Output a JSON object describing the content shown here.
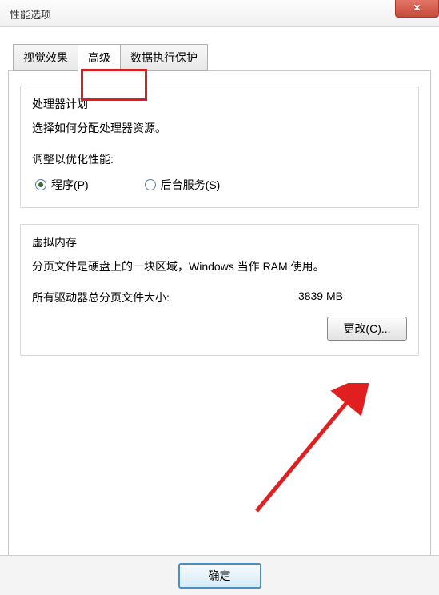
{
  "window": {
    "title": "性能选项",
    "close_icon": "✕"
  },
  "tabs": {
    "visual": "视觉效果",
    "advanced": "高级",
    "dep": "数据执行保护"
  },
  "processor": {
    "title": "处理器计划",
    "desc": "选择如何分配处理器资源。",
    "adjust_label": "调整以优化性能:",
    "option_programs": "程序(P)",
    "option_background": "后台服务(S)"
  },
  "vm": {
    "title": "虚拟内存",
    "desc": "分页文件是硬盘上的一块区域，Windows 当作 RAM 使用。",
    "total_label": "所有驱动器总分页文件大小:",
    "total_value": "3839 MB",
    "change_btn": "更改(C)..."
  },
  "buttons": {
    "ok": "确定"
  }
}
